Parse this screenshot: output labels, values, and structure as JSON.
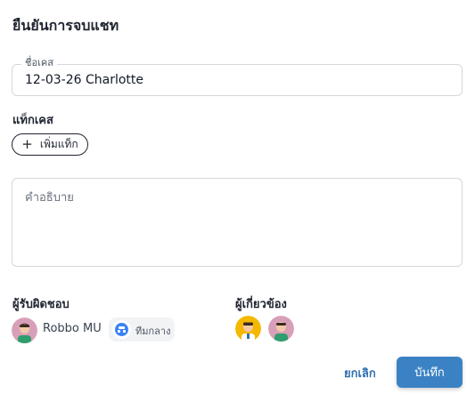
{
  "dialog": {
    "title": "ยืนยันการจบแชท"
  },
  "case_name": {
    "label": "ชื่อเคส",
    "value": "12-03-26 Charlotte"
  },
  "tags": {
    "label": "แท็กเคส",
    "add_button_label": "เพิ่มแท็ก",
    "add_icon": "+"
  },
  "description": {
    "placeholder": "คำอธิบาย"
  },
  "assignee": {
    "label": "ผู้รับผิดชอบ",
    "name": "Robbo MU",
    "team": "ทีมกลาง"
  },
  "participants": {
    "label": "ผู้เกี่ยวข้อง"
  },
  "actions": {
    "cancel_label": "ยกเลิก",
    "save_label": "บันทึก"
  },
  "colors": {
    "accent": "#3b82c4",
    "cancel": "#2f6fb0",
    "avatar_pink": "#d8a0b8",
    "avatar_yellow": "#f5b800"
  }
}
